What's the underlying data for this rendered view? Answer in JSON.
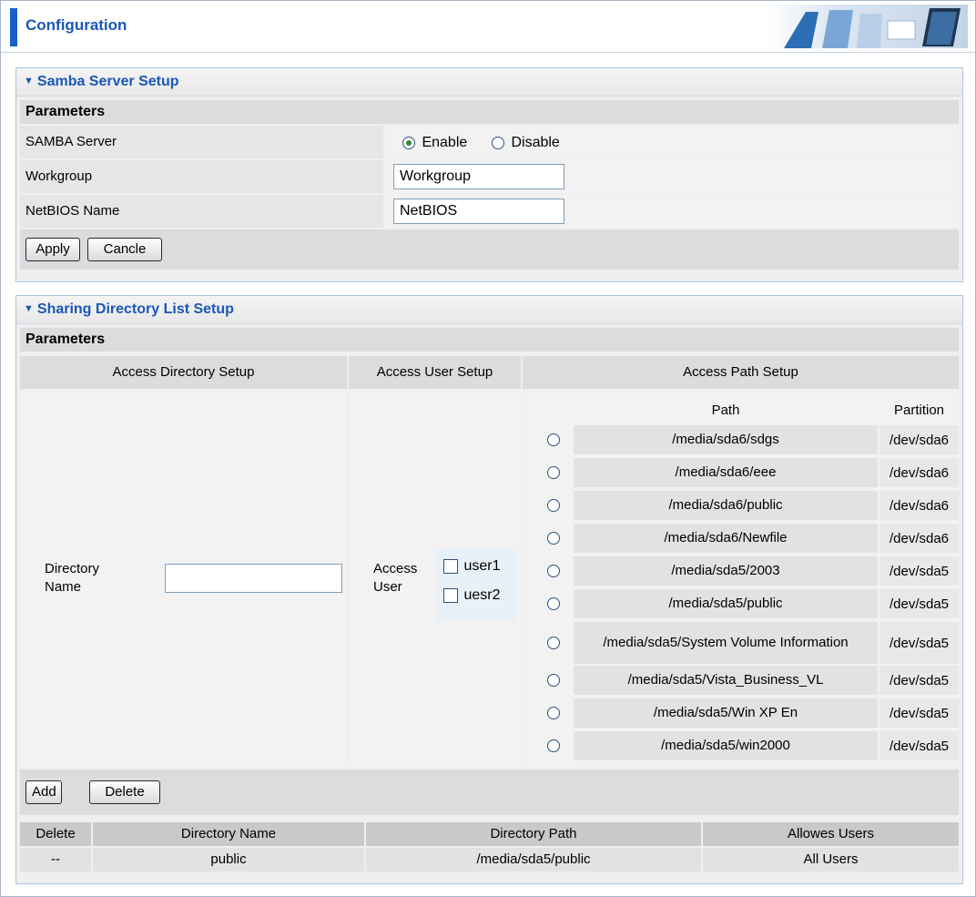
{
  "header": {
    "title": "Configuration"
  },
  "samba": {
    "section_title": "Samba Server Setup",
    "params_label": "Parameters",
    "server_label": "SAMBA Server",
    "enable_label": "Enable",
    "disable_label": "Disable",
    "selected": "Enable",
    "workgroup_label": "Workgroup",
    "workgroup_value": "Workgroup",
    "netbios_label": "NetBIOS Name",
    "netbios_value": "NetBIOS",
    "apply_label": "Apply",
    "cancel_label": "Cancle"
  },
  "sharing": {
    "section_title": "Sharing Directory List Setup",
    "params_label": "Parameters",
    "col_directory": "Access Directory Setup",
    "col_user": "Access User Setup",
    "col_path": "Access Path Setup",
    "dir_name_label": "Directory Name",
    "dir_name_value": "",
    "access_user_label": "Access User",
    "users": [
      "user1",
      "uesr2"
    ],
    "path_header": "Path",
    "partition_header": "Partition",
    "paths": [
      {
        "path": "/media/sda6/sdgs",
        "partition": "/dev/sda6"
      },
      {
        "path": "/media/sda6/eee",
        "partition": "/dev/sda6"
      },
      {
        "path": "/media/sda6/public",
        "partition": "/dev/sda6"
      },
      {
        "path": "/media/sda6/Newfile",
        "partition": "/dev/sda6"
      },
      {
        "path": "/media/sda5/2003",
        "partition": "/dev/sda5"
      },
      {
        "path": "/media/sda5/public",
        "partition": "/dev/sda5"
      },
      {
        "path": "/media/sda5/System Volume Information",
        "partition": "/dev/sda5"
      },
      {
        "path": "/media/sda5/Vista_Business_VL",
        "partition": "/dev/sda5"
      },
      {
        "path": "/media/sda5/Win XP En",
        "partition": "/dev/sda5"
      },
      {
        "path": "/media/sda5/win2000",
        "partition": "/dev/sda5"
      }
    ],
    "add_label": "Add",
    "delete_label": "Delete",
    "table": {
      "headers": [
        "Delete",
        "Directory Name",
        "Directory Path",
        "Allowes Users"
      ],
      "rows": [
        [
          "--",
          "public",
          "/media/sda5/public",
          "All Users"
        ]
      ]
    }
  }
}
